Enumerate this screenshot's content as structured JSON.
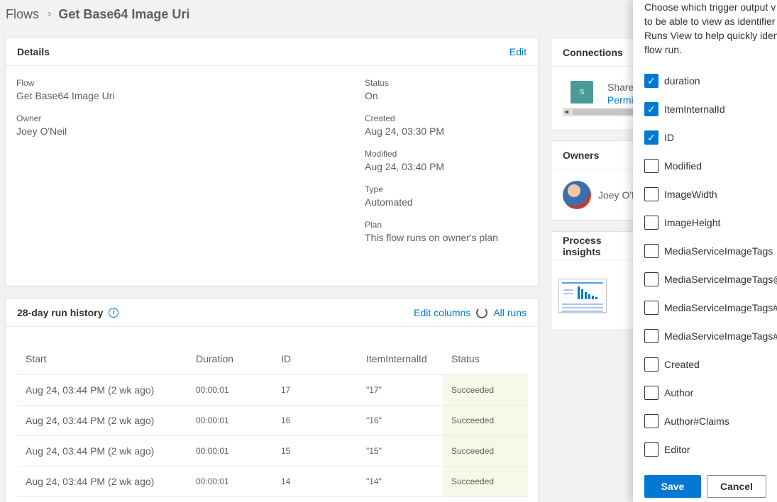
{
  "breadcrumb": {
    "root": "Flows",
    "current": "Get Base64 Image Uri"
  },
  "details": {
    "title": "Details",
    "edit": "Edit",
    "flow_label": "Flow",
    "flow_value": "Get Base64 Image Uri",
    "owner_label": "Owner",
    "owner_value": "Joey O'Neil",
    "status_label": "Status",
    "status_value": "On",
    "created_label": "Created",
    "created_value": "Aug 24, 03:30 PM",
    "modified_label": "Modified",
    "modified_value": "Aug 24, 03:40 PM",
    "type_label": "Type",
    "type_value": "Automated",
    "plan_label": "Plan",
    "plan_value": "This flow runs on owner's plan"
  },
  "runs": {
    "title": "28-day run history",
    "edit_columns": "Edit columns",
    "all_runs": "All runs",
    "columns": [
      "Start",
      "Duration",
      "ID",
      "ItemInternalId",
      "Status"
    ],
    "rows": [
      {
        "start": "Aug 24, 03:44 PM (2 wk ago)",
        "duration": "00:00:01",
        "id": "17",
        "item": "\"17\"",
        "status": "Succeeded"
      },
      {
        "start": "Aug 24, 03:44 PM (2 wk ago)",
        "duration": "00:00:01",
        "id": "16",
        "item": "\"16\"",
        "status": "Succeeded"
      },
      {
        "start": "Aug 24, 03:44 PM (2 wk ago)",
        "duration": "00:00:01",
        "id": "15",
        "item": "\"15\"",
        "status": "Succeeded"
      },
      {
        "start": "Aug 24, 03:44 PM (2 wk ago)",
        "duration": "00:00:01",
        "id": "14",
        "item": "\"14\"",
        "status": "Succeeded"
      }
    ]
  },
  "connections": {
    "title": "Connections",
    "name": "ShareP",
    "permission": "Permis",
    "icon": "sharepoint-icon"
  },
  "owners": {
    "title": "Owners",
    "name": "Joey O'N"
  },
  "insights": {
    "title": "Process insights"
  },
  "panel": {
    "description": "Choose which trigger output v\nto be able to view as identifier\nRuns View to help quickly iden\nflow run.",
    "options": [
      {
        "label": "duration",
        "checked": true
      },
      {
        "label": "ItemInternalId",
        "checked": true
      },
      {
        "label": "ID",
        "checked": true
      },
      {
        "label": "Modified",
        "checked": false
      },
      {
        "label": "ImageWidth",
        "checked": false
      },
      {
        "label": "ImageHeight",
        "checked": false
      },
      {
        "label": "MediaServiceImageTags",
        "checked": false
      },
      {
        "label": "MediaServiceImageTags@",
        "checked": false
      },
      {
        "label": "MediaServiceImageTags#V",
        "checked": false
      },
      {
        "label": "MediaServiceImageTags#V",
        "checked": false
      },
      {
        "label": "Created",
        "checked": false
      },
      {
        "label": "Author",
        "checked": false
      },
      {
        "label": "Author#Claims",
        "checked": false
      },
      {
        "label": "Editor",
        "checked": false
      }
    ],
    "save": "Save",
    "cancel": "Cancel"
  },
  "colors": {
    "accent": "#0078d4",
    "succeeded_bg": "#f5f9e8"
  }
}
